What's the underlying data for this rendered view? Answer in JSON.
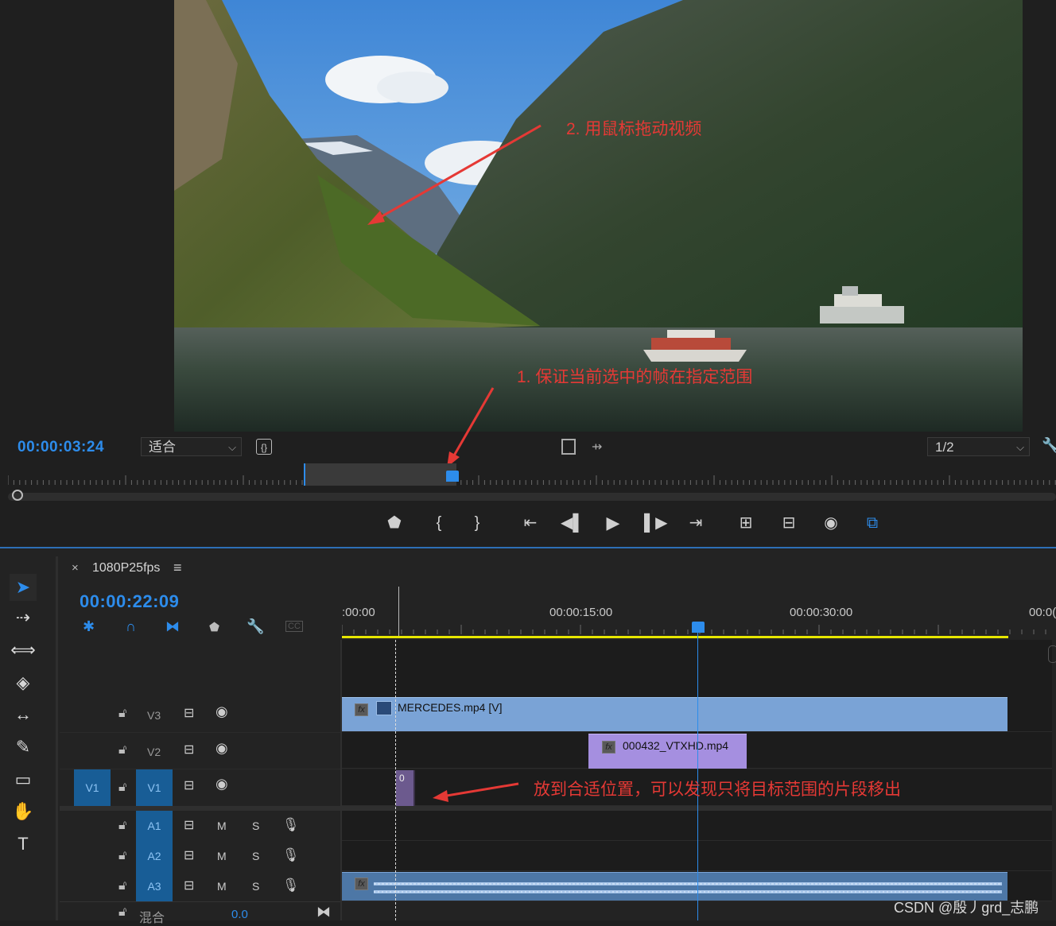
{
  "program_monitor": {
    "timecode": "00:00:03:24",
    "zoom_select": "适合",
    "resolution_select": "1/2",
    "controls": [
      "add-marker",
      "mark-in",
      "mark-out",
      "go-to-in",
      "step-back",
      "play",
      "step-forward",
      "go-to-out",
      "insert",
      "overwrite",
      "export-frame",
      "button-editor"
    ]
  },
  "annotations": {
    "a1": "1. 保证当前选中的帧在指定范围",
    "a2": "2. 用鼠标拖动视频",
    "a3": "放到合适位置，可以发现只将目标范围的片段移出"
  },
  "timeline": {
    "sequence_name": "1080P25fps",
    "close": "×",
    "menu": "≡",
    "timecode": "00:00:22:09",
    "ruler_labels": [
      ":00:00",
      "00:00:15:00",
      "00:00:30:00",
      "00:0("
    ],
    "tracks": {
      "v3": "V3",
      "v2": "V2",
      "v1": "V1",
      "v1_source": "V1",
      "a1": "A1",
      "a2": "A2",
      "a3": "A3",
      "mute": "M",
      "solo": "S"
    },
    "mix_label": "混合",
    "mix_value": "0.0",
    "clips": {
      "v3_clip": "MERCEDES.mp4 [V]",
      "v2_clip": "000432_VTXHD.mp4",
      "v1_clip": "0"
    }
  },
  "watermark": "CSDN @殷丿grd_志鹏",
  "colors": {
    "accent_blue": "#2d8ceb",
    "clip_blue": "#7aa3d6",
    "clip_purple": "#a58fe0",
    "annotation_red": "#e53935",
    "work_area_yellow": "#e6e600"
  }
}
